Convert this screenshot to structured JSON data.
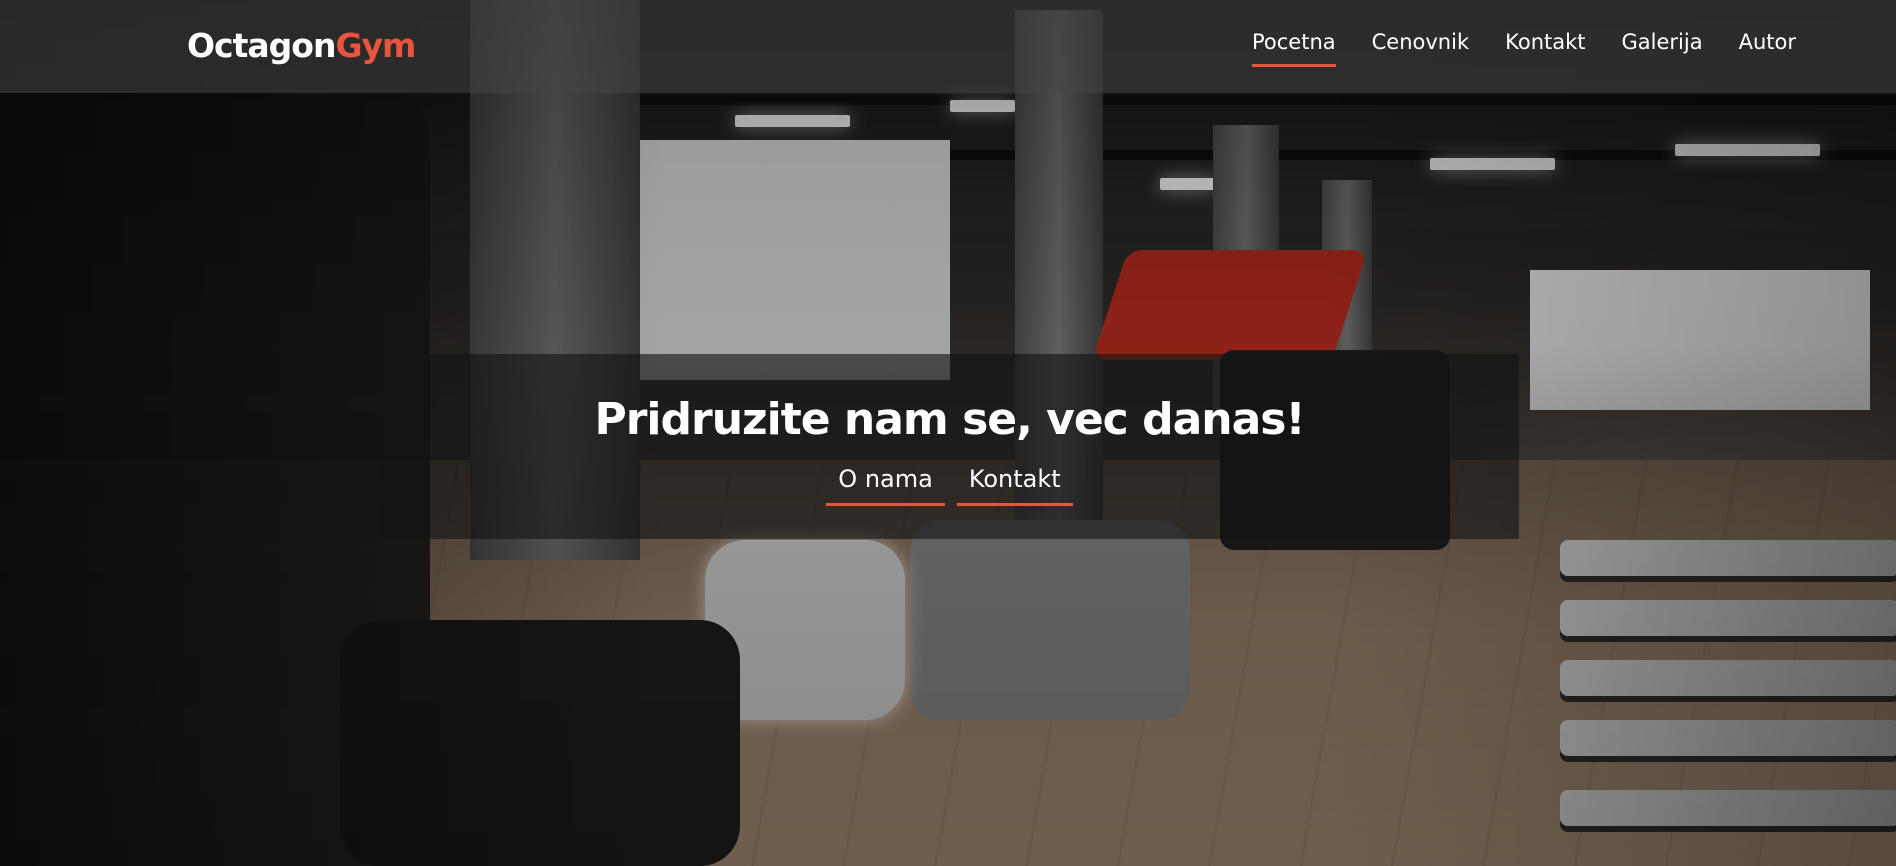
{
  "brand": {
    "name_main": "Octagon",
    "name_accent": "Gym",
    "accent_color": "#e8553e"
  },
  "nav": {
    "items": [
      {
        "label": "Pocetna",
        "active": true
      },
      {
        "label": "Cenovnik",
        "active": false
      },
      {
        "label": "Kontakt",
        "active": false
      },
      {
        "label": "Galerija",
        "active": false
      },
      {
        "label": "Autor",
        "active": false
      }
    ]
  },
  "hero": {
    "title": "Pridruzite nam se, vec danas!",
    "links": [
      {
        "label": "O nama"
      },
      {
        "label": "Kontakt"
      }
    ]
  }
}
